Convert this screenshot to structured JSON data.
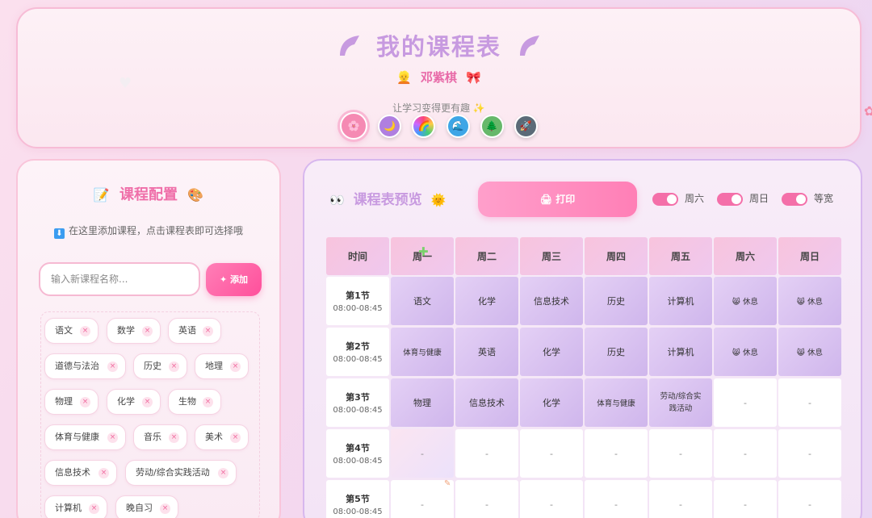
{
  "header": {
    "title": "我的课程表",
    "user_name": "邓紫棋",
    "user_emoji_left": "👱",
    "user_emoji_right": "🎀",
    "motto": "让学习变得更有趣 ✨",
    "themes": [
      {
        "icon": "🌸",
        "color": "#f58ab3"
      },
      {
        "icon": "🌙",
        "color": "#b07fe0"
      },
      {
        "icon": "🌈",
        "color": "#f0c060"
      },
      {
        "icon": "🌊",
        "color": "#3ea6e6"
      },
      {
        "icon": "🌲",
        "color": "#66b86a"
      },
      {
        "icon": "🚀",
        "color": "#5b6b78"
      }
    ]
  },
  "config": {
    "title": "课程配置",
    "title_left_emoji": "📝",
    "title_right_emoji": "🎨",
    "hint": "在这里添加课程，点击课程表即可选择哦",
    "hint_icon": "⬇",
    "input_placeholder": "输入新课程名称...",
    "add_label": "✦ 添加",
    "remove_glyph": "×",
    "courses": [
      "语文",
      "数学",
      "英语",
      "道德与法治",
      "历史",
      "地理",
      "物理",
      "化学",
      "生物",
      "体育与健康",
      "音乐",
      "美术",
      "信息技术",
      "劳动/综合实践活动",
      "计算机",
      "晚自习"
    ]
  },
  "preview": {
    "title": "课程表预览",
    "title_left_emoji": "👀",
    "title_right_emoji": "🌞",
    "print_label": "🖨 打印",
    "toggles": [
      "周六",
      "周日",
      "等宽"
    ],
    "columns": [
      "时间",
      "周一",
      "周二",
      "周三",
      "周四",
      "周五",
      "周六",
      "周日"
    ],
    "periods": [
      {
        "name": "第1节",
        "time": "08:00-08:45",
        "cells": [
          "语文",
          "化学",
          "信息技术",
          "历史",
          "计算机",
          "😸 休息",
          "😸 休息"
        ]
      },
      {
        "name": "第2节",
        "time": "08:00-08:45",
        "cells": [
          "体育与健康",
          "英语",
          "化学",
          "历史",
          "计算机",
          "😸 休息",
          "😸 休息"
        ]
      },
      {
        "name": "第3节",
        "time": "08:00-08:45",
        "cells": [
          "物理",
          "信息技术",
          "化学",
          "体育与健康",
          "劳动/综合实践活动",
          "-",
          "-"
        ]
      },
      {
        "name": "第4节",
        "time": "08:00-08:45",
        "cells": [
          "-",
          "-",
          "-",
          "-",
          "-",
          "-",
          "-"
        ]
      },
      {
        "name": "第5节",
        "time": "08:00-08:45",
        "cells": [
          "-",
          "-",
          "-",
          "-",
          "-",
          "-",
          "-"
        ]
      }
    ]
  }
}
